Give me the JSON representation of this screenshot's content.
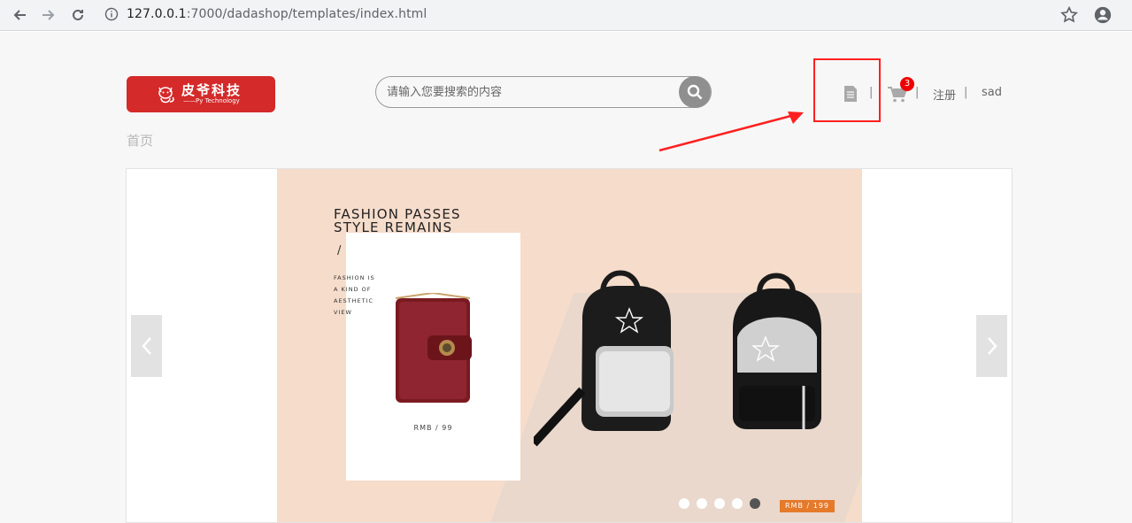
{
  "browser": {
    "url_host": "127.0.0.1",
    "url_rest": ":7000/dadashop/templates/index.html"
  },
  "header": {
    "logo_cn": "皮爷科技",
    "logo_en": "——Py Technology",
    "search_placeholder": "请输入您要搜索的内容",
    "cart_count": "3",
    "register": "注册",
    "username": "sad",
    "separator": "|"
  },
  "breadcrumb": "首页",
  "banner": {
    "title_line1": "FASHION PASSES",
    "title_line2": "STYLE REMAINS",
    "slash": "/",
    "copy": [
      "FASHION IS",
      "A KIND OF",
      "AESTHETIC",
      "VIEW"
    ],
    "price_left": "RMB / 99",
    "price_right": "RMB / 199",
    "dots": [
      false,
      false,
      false,
      false,
      true
    ]
  },
  "colors": {
    "brand_red": "#d42a2a",
    "annotation_red": "#ff2020",
    "badge_red": "#ee0000",
    "banner_bg": "#f6dccb",
    "price_tag": "#e57a2b"
  }
}
